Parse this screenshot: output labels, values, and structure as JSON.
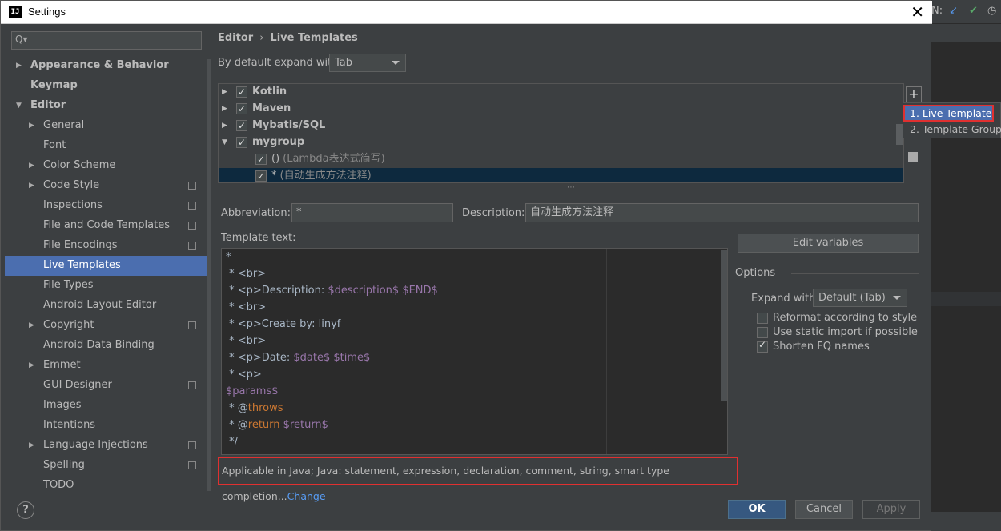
{
  "window": {
    "title": "Settings",
    "app_icon": "IJ",
    "close_glyph": "✕"
  },
  "ide_bg": {
    "label": "N:",
    "icon1": "↙",
    "icon2": "✔",
    "icon3": "◷"
  },
  "sidebar": {
    "search_placeholder": "",
    "search_icon": "Q▾",
    "items": [
      {
        "label": "Appearance & Behavior",
        "bold": true,
        "arrow": "▶",
        "level": 0
      },
      {
        "label": "Keymap",
        "bold": true,
        "arrow": "",
        "level": 0
      },
      {
        "label": "Editor",
        "bold": true,
        "arrow": "▼",
        "level": 0
      },
      {
        "label": "General",
        "arrow": "▶",
        "level": 1
      },
      {
        "label": "Font",
        "arrow": "",
        "level": 1
      },
      {
        "label": "Color Scheme",
        "arrow": "▶",
        "level": 1
      },
      {
        "label": "Code Style",
        "arrow": "▶",
        "level": 1,
        "proj": true
      },
      {
        "label": "Inspections",
        "arrow": "",
        "level": 1,
        "proj": true
      },
      {
        "label": "File and Code Templates",
        "arrow": "",
        "level": 1,
        "proj": true
      },
      {
        "label": "File Encodings",
        "arrow": "",
        "level": 1,
        "proj": true
      },
      {
        "label": "Live Templates",
        "arrow": "",
        "level": 1,
        "selected": true
      },
      {
        "label": "File Types",
        "arrow": "",
        "level": 1
      },
      {
        "label": "Android Layout Editor",
        "arrow": "",
        "level": 1
      },
      {
        "label": "Copyright",
        "arrow": "▶",
        "level": 1,
        "proj": true
      },
      {
        "label": "Android Data Binding",
        "arrow": "",
        "level": 1
      },
      {
        "label": "Emmet",
        "arrow": "▶",
        "level": 1
      },
      {
        "label": "GUI Designer",
        "arrow": "",
        "level": 1,
        "proj": true
      },
      {
        "label": "Images",
        "arrow": "",
        "level": 1
      },
      {
        "label": "Intentions",
        "arrow": "",
        "level": 1
      },
      {
        "label": "Language Injections",
        "arrow": "▶",
        "level": 1,
        "proj": true
      },
      {
        "label": "Spelling",
        "arrow": "",
        "level": 1,
        "proj": true
      },
      {
        "label": "TODO",
        "arrow": "",
        "level": 1
      }
    ]
  },
  "breadcrumb": {
    "parent": "Editor",
    "sep": "›",
    "current": "Live Templates"
  },
  "expand": {
    "label": "By default expand with",
    "value": "Tab"
  },
  "tree": [
    {
      "label": "Kotlin",
      "arrow": "▶",
      "checked": true,
      "bold": true,
      "indent": 0
    },
    {
      "label": "Maven",
      "arrow": "▶",
      "checked": true,
      "bold": true,
      "indent": 0
    },
    {
      "label": "Mybatis/SQL",
      "arrow": "▶",
      "checked": true,
      "bold": true,
      "indent": 0
    },
    {
      "label": "mygroup",
      "arrow": "▼",
      "checked": true,
      "bold": true,
      "indent": 0
    },
    {
      "label": "()",
      "desc": "(Lambda表达式简写)",
      "arrow": "",
      "checked": true,
      "indent": 1
    },
    {
      "label": "*",
      "desc": "(自动生成方法注释)",
      "arrow": "",
      "checked": true,
      "indent": 1,
      "selected": true
    }
  ],
  "tree_buttons": {
    "add": "+"
  },
  "popup": {
    "items": [
      "1. Live Template",
      "2. Template Group..."
    ]
  },
  "abbreviation": {
    "label": "Abbreviation:",
    "value": "*"
  },
  "description": {
    "label": "Description:",
    "value": "自动生成方法注释"
  },
  "template_text": {
    "label": "Template text:",
    "lines": [
      [
        {
          "t": "*",
          "c": "txt"
        }
      ],
      [
        {
          "t": " * <br>",
          "c": "txt"
        }
      ],
      [
        {
          "t": " * <p>Description: ",
          "c": "txt"
        },
        {
          "t": "$description$ $END$",
          "c": "var"
        }
      ],
      [
        {
          "t": " * <br>",
          "c": "txt"
        }
      ],
      [
        {
          "t": " * <p>Create by: linyf",
          "c": "txt"
        }
      ],
      [
        {
          "t": " * <br>",
          "c": "txt"
        }
      ],
      [
        {
          "t": " * <p>Date: ",
          "c": "txt"
        },
        {
          "t": "$date$ $time$",
          "c": "var"
        }
      ],
      [
        {
          "t": " * <p>",
          "c": "txt"
        }
      ],
      [
        {
          "t": "$params$",
          "c": "var"
        }
      ],
      [
        {
          "t": " * @",
          "c": "txt"
        },
        {
          "t": "throws",
          "c": "kw"
        }
      ],
      [
        {
          "t": " * @",
          "c": "txt"
        },
        {
          "t": "return",
          "c": "kw"
        },
        {
          "t": " ",
          "c": "txt"
        },
        {
          "t": "$return$",
          "c": "var"
        }
      ],
      [
        {
          "t": " */",
          "c": "txt"
        }
      ]
    ]
  },
  "applicable": {
    "text": "Applicable in Java; Java: statement, expression, declaration, comment, string, smart type completion...",
    "link": "Change"
  },
  "edit_variables": "Edit variables",
  "options": {
    "title": "Options",
    "expand_label": "Expand with",
    "expand_value": "Default (Tab)",
    "checks": [
      {
        "label": "Reformat according to style",
        "checked": false
      },
      {
        "label": "Use static import if possible",
        "checked": false
      },
      {
        "label": "Shorten FQ names",
        "checked": true
      }
    ]
  },
  "buttons": {
    "ok": "OK",
    "cancel": "Cancel",
    "apply": "Apply",
    "help": "?"
  },
  "colors": {
    "selection": "#4b6eaf",
    "highlight_border": "#e03030",
    "link": "#589df6",
    "template_var": "#9876aa",
    "keyword": "#cc7832"
  }
}
